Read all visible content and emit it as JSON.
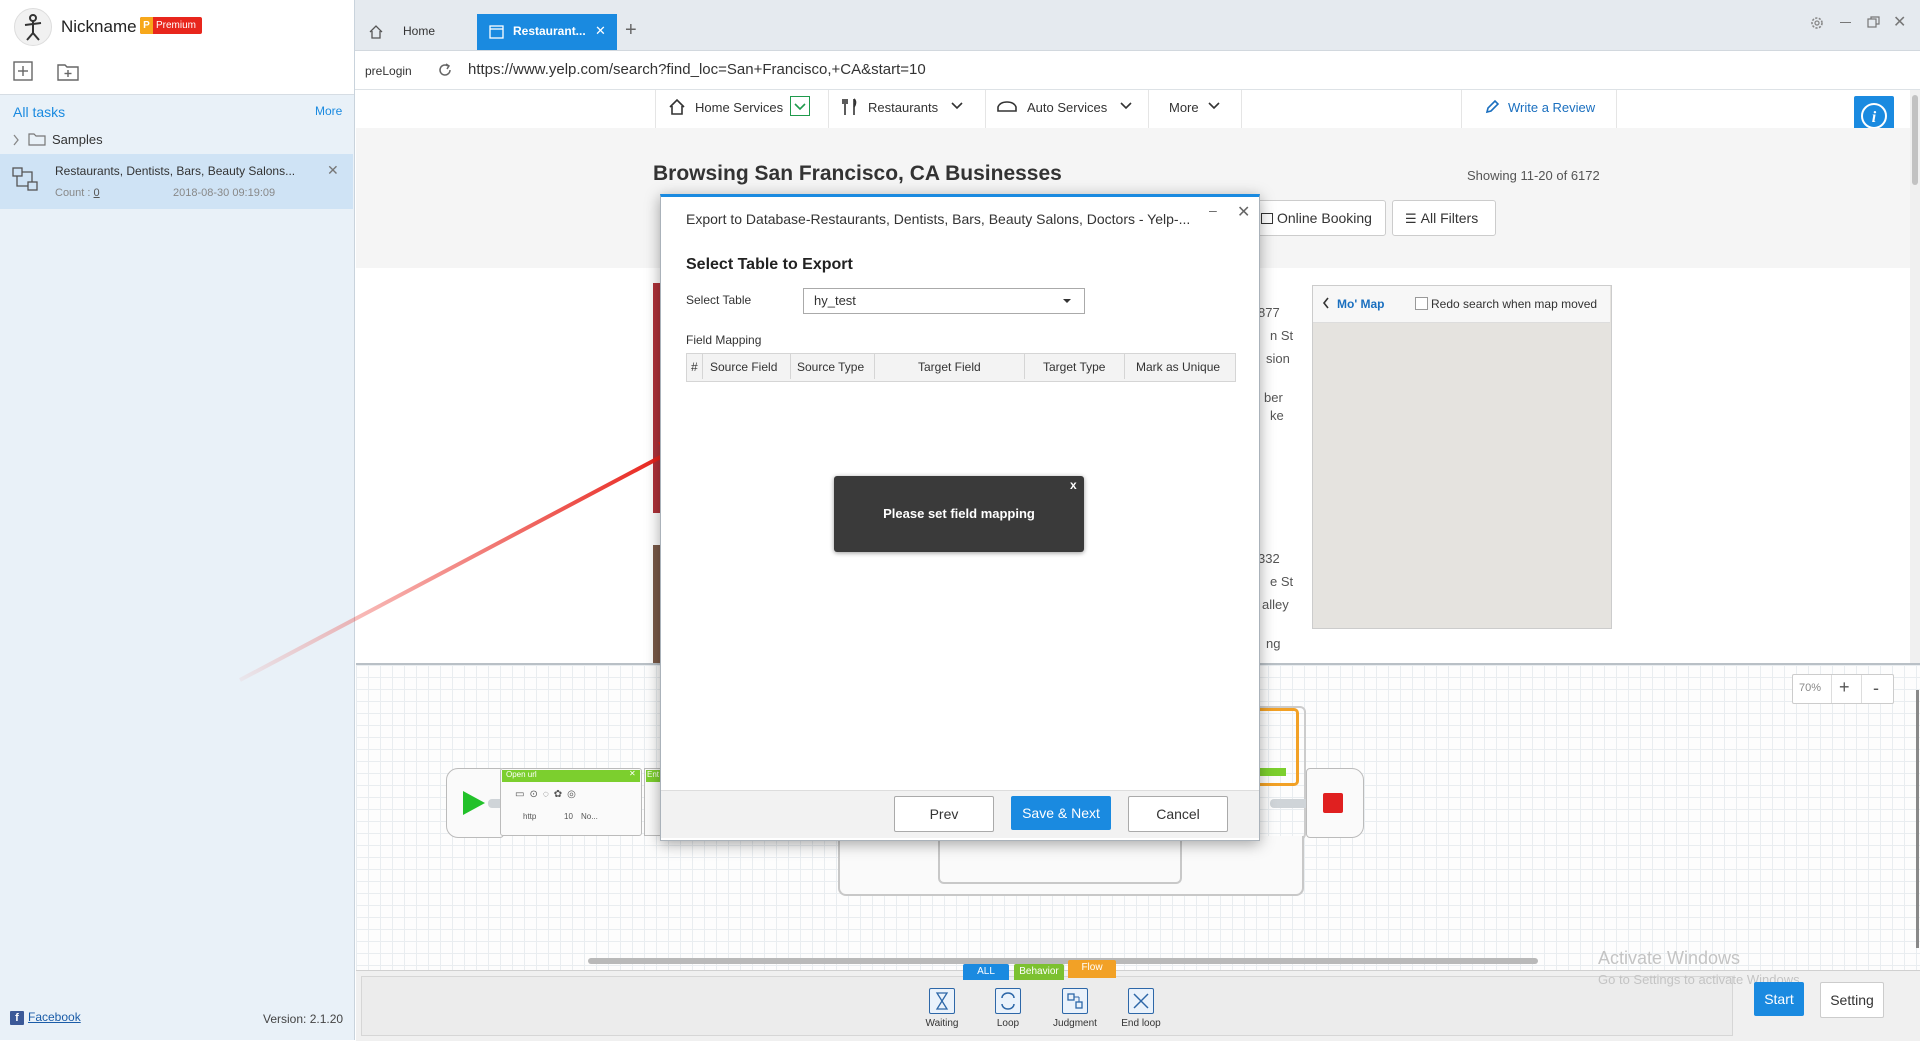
{
  "app": {
    "nickname": "Nickname",
    "premium_badge": "Premium",
    "premium_letter": "P",
    "version": "Version: 2.1.20",
    "facebook": "Facebook"
  },
  "sidebar": {
    "all_tasks": "All tasks",
    "more": "More",
    "folder": "Samples",
    "task": {
      "name": "Restaurants, Dentists, Bars, Beauty Salons...",
      "count_label": "Count :",
      "count_value": "0",
      "date": "2018-08-30 09:19:09"
    }
  },
  "tabs": {
    "home": "Home",
    "active": "Restaurant...",
    "add": "+"
  },
  "address": {
    "prelogin": "preLogin",
    "url": "https://www.yelp.com/search?find_loc=San+Francisco,+CA&start=10"
  },
  "yelp": {
    "nav": [
      "Home Services",
      "Restaurants",
      "Auto Services",
      "More"
    ],
    "write_review": "Write a Review",
    "heading": "Browsing San Francisco, CA Businesses",
    "showing": "Showing 11-20 of 6172",
    "filters": [
      "Online Booking",
      "All Filters"
    ],
    "map_title": "Mo' Map",
    "redo_search": "Redo search when map moved",
    "fragments": [
      "877",
      "n St",
      "sion",
      "ber",
      "ke",
      "332",
      "e St",
      "alley",
      "ng"
    ]
  },
  "workflow": {
    "zoom": "70%",
    "zoom_in": "+",
    "zoom_out": "-",
    "open_url": "Open url",
    "ent_label": "Ent",
    "mini_fields": [
      "http",
      "10",
      "No..."
    ]
  },
  "bottombar": {
    "tabs": [
      "ALL",
      "Behavior",
      "Flow"
    ],
    "items": [
      "Waiting",
      "Loop",
      "Judgment",
      "End loop"
    ],
    "start": "Start",
    "setting": "Setting",
    "activate_title": "Activate Windows",
    "activate_sub": "Go to Settings to activate Windows."
  },
  "dialog": {
    "title": "Export to Database-Restaurants, Dentists, Bars, Beauty Salons, Doctors - Yelp-...",
    "minimize": "–",
    "close": "✕",
    "heading": "Select Table to Export",
    "select_label": "Select Table",
    "select_value": "hy_test",
    "field_mapping": "Field Mapping",
    "columns": [
      "#",
      "Source Field",
      "Source Type",
      "Target Field",
      "Target Type",
      "Mark as Unique"
    ],
    "toast": "Please set field mapping",
    "toast_close": "x",
    "prev": "Prev",
    "save_next": "Save & Next",
    "cancel": "Cancel"
  },
  "colors": {
    "accent": "#1a8ae0",
    "premium": "#e8261c",
    "start_green": "#22c12a",
    "stop_red": "#e02020",
    "arrow_red": "#e8221a"
  }
}
